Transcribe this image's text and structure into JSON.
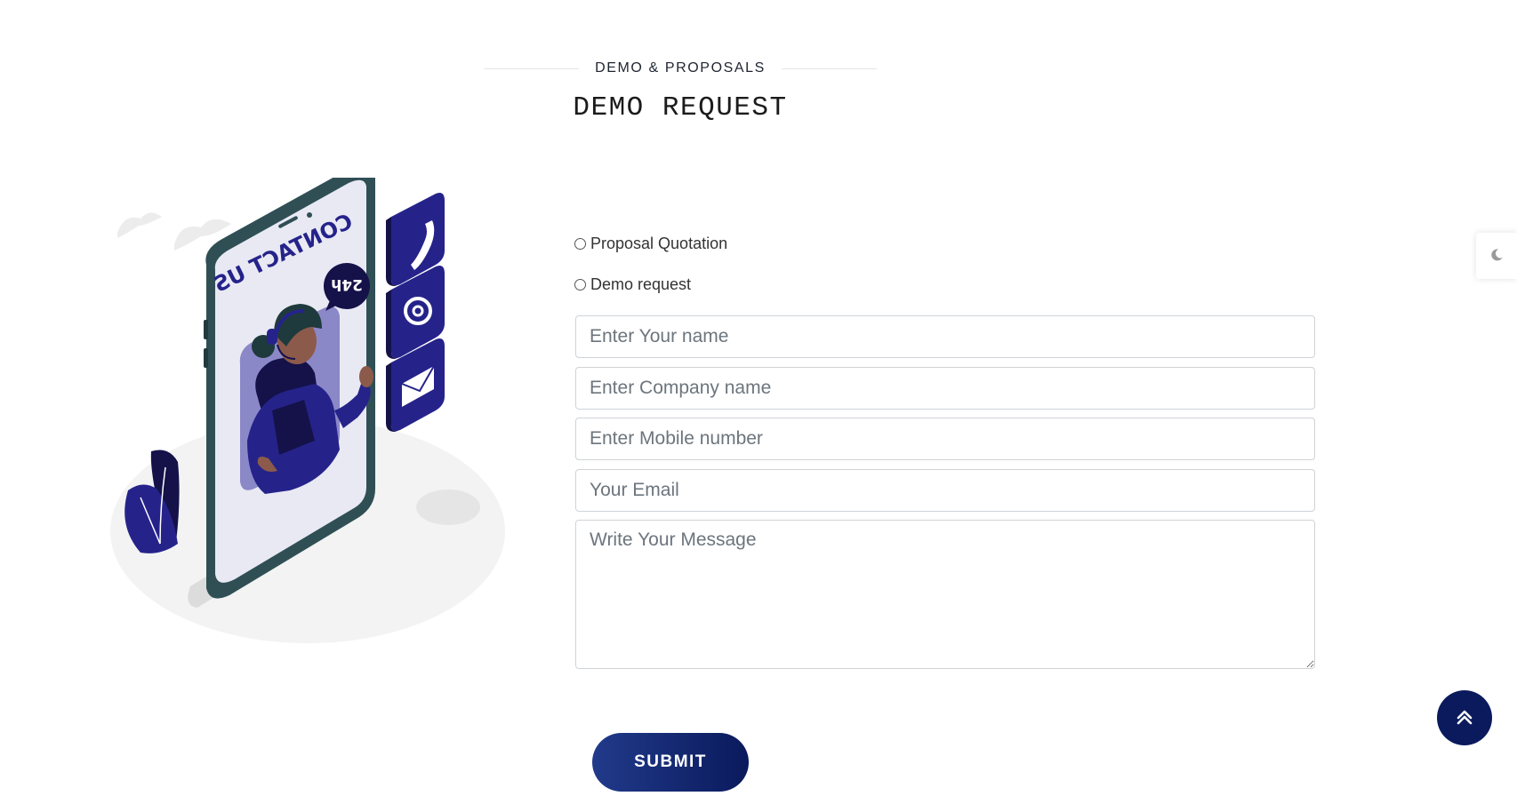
{
  "section": {
    "subtitle": "DEMO & PROPOSALS",
    "title": "DEMO REQUEST"
  },
  "illustration": {
    "screen_text": "CONTACT US",
    "badge_text": "24h",
    "side_icons": [
      "phone-icon",
      "at-sign-icon",
      "envelope-icon"
    ]
  },
  "form": {
    "options": [
      {
        "label": "Proposal Quotation",
        "selected": false
      },
      {
        "label": "Demo request",
        "selected": false
      }
    ],
    "name_placeholder": "Enter Your name",
    "company_placeholder": "Enter Company name",
    "mobile_placeholder": "Enter Mobile number",
    "email_placeholder": "Your Email",
    "message_placeholder": "Write Your Message",
    "submit_label": "SUBMIT"
  },
  "controls": {
    "scroll_top_icon": "double-chevron-up-icon",
    "theme_toggle_icon": "moon-icon"
  },
  "colors": {
    "accent": "#0a1a5c",
    "illustration_primary": "#25238a",
    "phone_frame": "#2f4f55"
  }
}
